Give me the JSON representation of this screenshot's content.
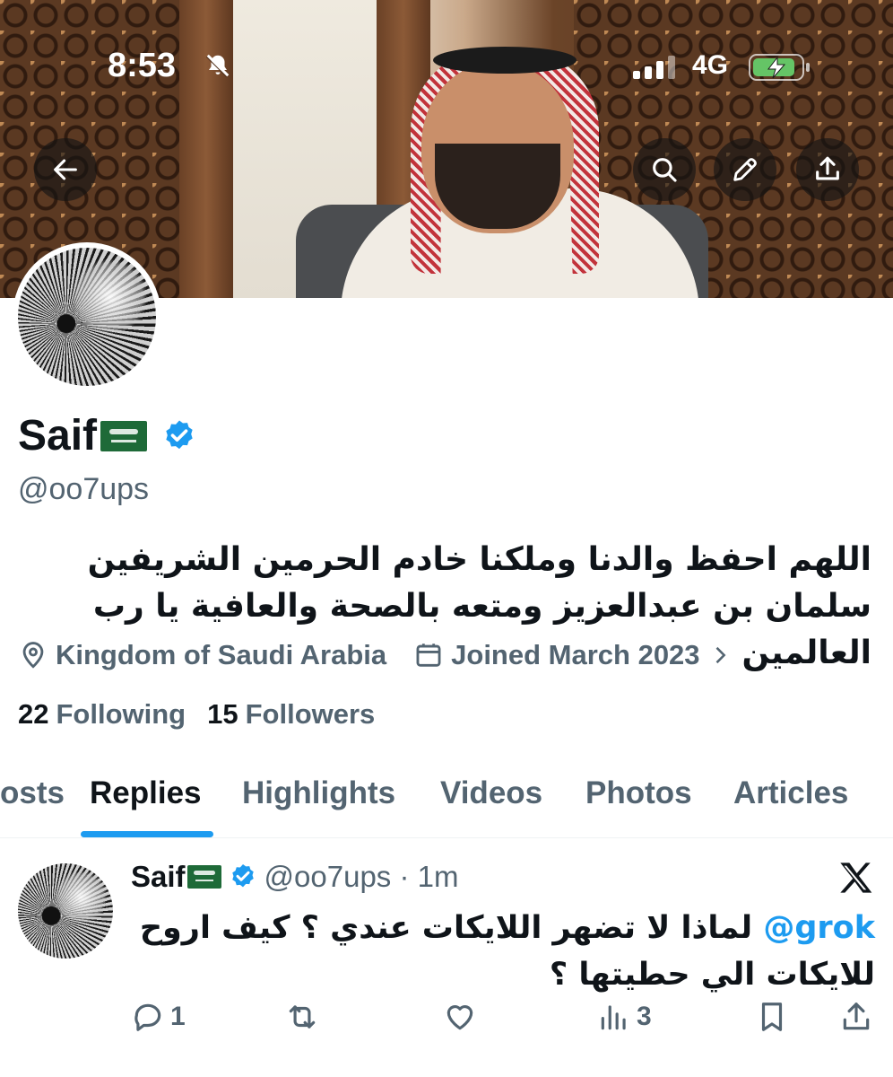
{
  "status_bar": {
    "time": "8:53",
    "network": "4G",
    "icons": [
      "bell-slash-icon",
      "signal-bars-icon",
      "battery-charging-icon"
    ]
  },
  "header_buttons": [
    "back-arrow-icon",
    "search-icon",
    "pencil-icon",
    "share-icon"
  ],
  "profile": {
    "name": "Saif",
    "handle": "@oo7ups",
    "bio": "اللهم احفظ والدنا وملكنا خادم الحرمين الشريفين سلمان بن عبدالعزيز ومتعه بالصحة والعافية يا رب العالمين",
    "location": "Kingdom of Saudi Arabia",
    "joined": "Joined March 2023",
    "following_count": "22",
    "following_label": "Following",
    "followers_count": "15",
    "followers_label": "Followers",
    "verified": true,
    "flag": "saudi-flag-icon"
  },
  "tabs": [
    {
      "label": "Posts",
      "visible_text": "osts",
      "active": false
    },
    {
      "label": "Replies",
      "active": true
    },
    {
      "label": "Highlights",
      "active": false
    },
    {
      "label": "Videos",
      "active": false
    },
    {
      "label": "Photos",
      "active": false
    },
    {
      "label": "Articles",
      "active": false
    }
  ],
  "reply": {
    "name": "Saif",
    "handle_time": "@oo7ups · 1m",
    "mention": "@grok",
    "text": "لماذا لا تضهر اللايكات عندي ؟ كيف اروح للايكات الي حطيتها ؟",
    "replies": "1",
    "retweets": "",
    "likes": "",
    "views": "3"
  },
  "colors": {
    "accent": "#1d9bf0",
    "text": "#0f1419",
    "secondary": "#536471",
    "verified": "#1d9bf0",
    "flag": "#1e6a38"
  }
}
